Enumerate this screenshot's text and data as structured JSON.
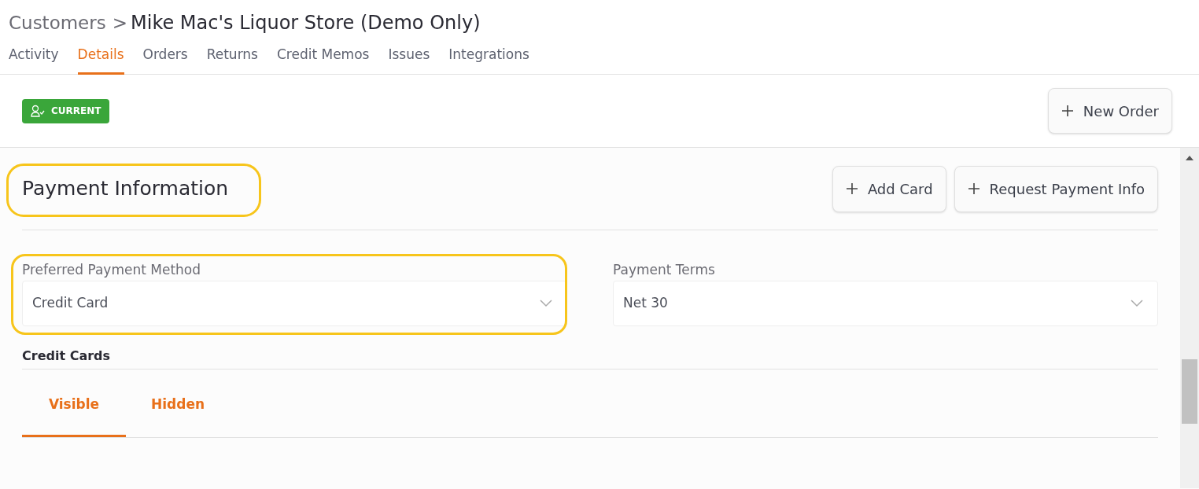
{
  "breadcrumb": {
    "parent": "Customers",
    "separator": ">",
    "title": "Mike Mac's Liquor Store (Demo Only)"
  },
  "tabs": [
    {
      "label": "Activity",
      "selected": false
    },
    {
      "label": "Details",
      "selected": true
    },
    {
      "label": "Orders",
      "selected": false
    },
    {
      "label": "Returns",
      "selected": false
    },
    {
      "label": "Credit Memos",
      "selected": false
    },
    {
      "label": "Issues",
      "selected": false
    },
    {
      "label": "Integrations",
      "selected": false
    }
  ],
  "status_badge": "CURRENT",
  "new_order_button": "New Order",
  "payment_section": {
    "title": "Payment Information",
    "highlighted": true,
    "buttons": [
      "Add Card",
      "Request Payment Info"
    ],
    "fields": [
      {
        "label": "Preferred Payment Method",
        "value": "Credit Card",
        "highlighted": true
      },
      {
        "label": "Payment Terms",
        "value": "Net 30",
        "highlighted": false
      }
    ],
    "credit_cards": {
      "title": "Credit Cards",
      "tabs": [
        {
          "label": "Visible",
          "selected": true
        },
        {
          "label": "Hidden",
          "selected": false
        }
      ]
    }
  }
}
